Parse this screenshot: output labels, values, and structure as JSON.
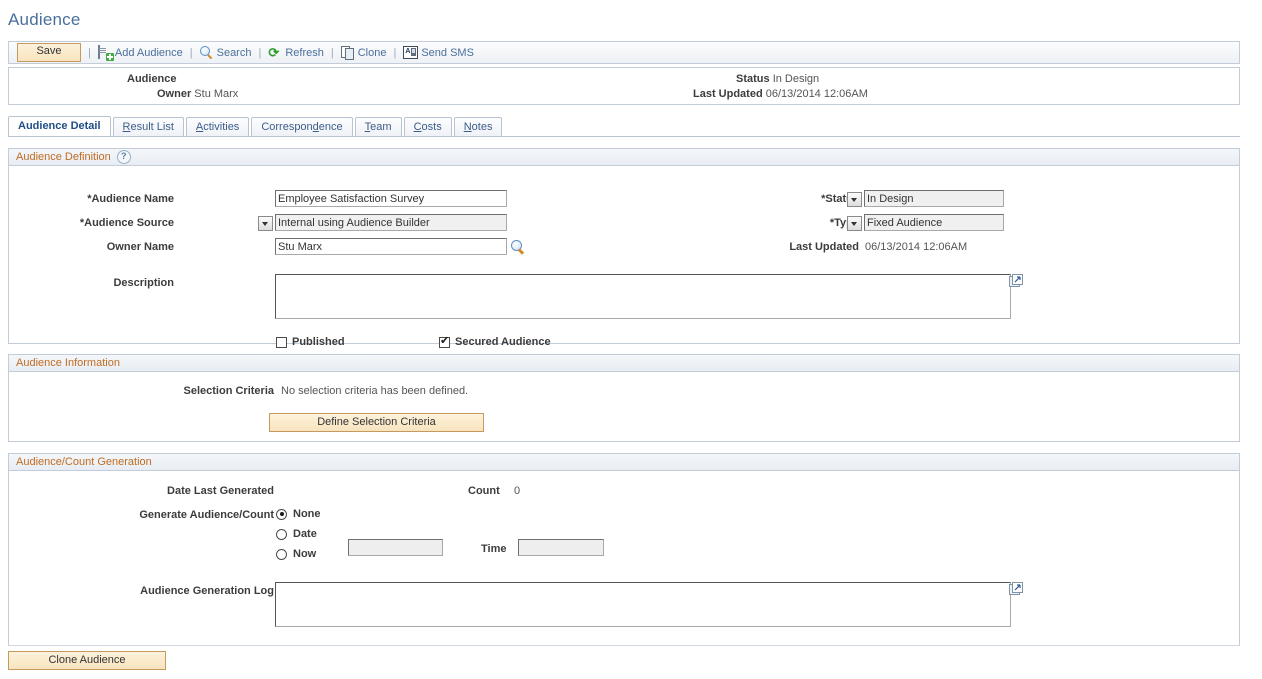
{
  "page": {
    "title": "Audience"
  },
  "toolbar": {
    "save_label": "Save",
    "items": [
      {
        "label": "Add Audience",
        "icon": "document-plus-icon"
      },
      {
        "label": "Search",
        "icon": "search-icon"
      },
      {
        "label": "Refresh",
        "icon": "refresh-icon"
      },
      {
        "label": "Clone",
        "icon": "clone-icon"
      },
      {
        "label": "Send SMS",
        "icon": "send-sms-icon"
      }
    ],
    "separator": "|"
  },
  "header": {
    "audience_label": "Audience",
    "audience_value": "",
    "owner_label": "Owner",
    "owner_value": "Stu Marx",
    "status_label": "Status",
    "status_value": "In Design",
    "last_updated_label": "Last Updated",
    "last_updated_value": "06/13/2014 12:06AM"
  },
  "tabs": [
    {
      "label": "Audience Detail",
      "accesskey": "",
      "active": true
    },
    {
      "label": "Result List",
      "accesskey": "R",
      "active": false
    },
    {
      "label": "Activities",
      "accesskey": "A",
      "active": false
    },
    {
      "label": "Correspondence",
      "accesskey": "d",
      "active": false
    },
    {
      "label": "Team",
      "accesskey": "T",
      "active": false
    },
    {
      "label": "Costs",
      "accesskey": "C",
      "active": false
    },
    {
      "label": "Notes",
      "accesskey": "N",
      "active": false
    }
  ],
  "audience_definition": {
    "section_title": "Audience Definition",
    "help_icon": "?",
    "audience_name_label": "*Audience Name",
    "audience_name_value": "Employee Satisfaction Survey",
    "audience_source_label": "*Audience Source",
    "audience_source_value": "Internal using Audience Builder",
    "audience_source_options": [
      "Internal using Audience Builder"
    ],
    "owner_name_label": "Owner Name",
    "owner_name_value": "Stu Marx",
    "owner_lookup_icon": "magnifier-lookup-icon",
    "description_label": "Description",
    "description_value": "",
    "description_expand_icon": "expand-textarea-icon",
    "status_label": "*Status",
    "status_value": "In Design",
    "status_options": [
      "In Design"
    ],
    "type_label": "*Type",
    "type_value": "Fixed Audience",
    "type_options": [
      "Fixed Audience"
    ],
    "last_updated_label": "Last Updated",
    "last_updated_value": "06/13/2014 12:06AM",
    "published_label": "Published",
    "published_checked": false,
    "secured_label": "Secured Audience",
    "secured_checked": true
  },
  "audience_information": {
    "section_title": "Audience Information",
    "selection_criteria_label": "Selection Criteria",
    "selection_criteria_value": "No selection criteria has been defined.",
    "define_button_label": "Define Selection Criteria"
  },
  "audience_count_generation": {
    "section_title": "Audience/Count Generation",
    "date_last_generated_label": "Date Last Generated",
    "date_last_generated_value": "",
    "count_label": "Count",
    "count_value": "0",
    "generate_label": "Generate Audience/Count",
    "radios": [
      {
        "label": "None",
        "selected": true
      },
      {
        "label": "Date",
        "selected": false
      },
      {
        "label": "Now",
        "selected": false
      }
    ],
    "date_value": "",
    "time_label": "Time",
    "time_value": "",
    "log_label": "Audience Generation Log",
    "log_value": "",
    "log_expand_icon": "expand-textarea-icon"
  },
  "footer": {
    "clone_audience_label": "Clone Audience"
  },
  "colors": {
    "title": "#4a6f9c",
    "section_header_text": "#c06c22",
    "link": "#4a6f9c",
    "button_face": "#f8e3bd",
    "button_border": "#c49a5e",
    "panel_border": "#c3cdd9"
  }
}
